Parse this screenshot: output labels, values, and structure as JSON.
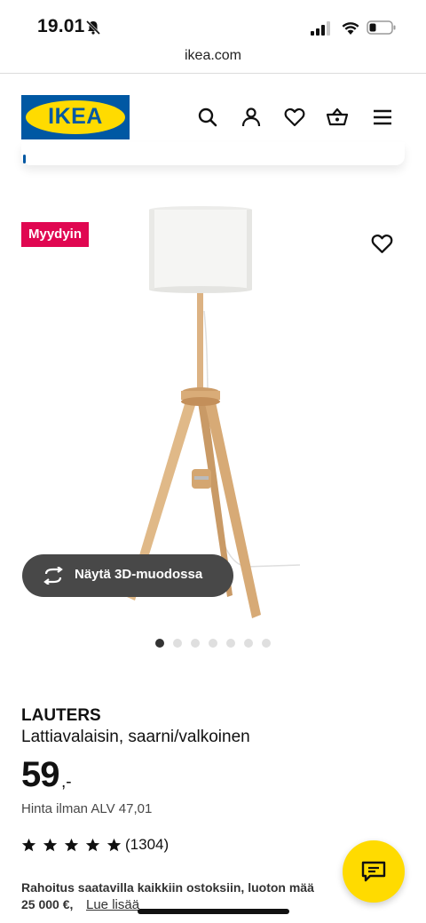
{
  "status_bar": {
    "time": "19.01",
    "icons": [
      "bell-slash-icon",
      "signal-icon",
      "wifi-icon",
      "battery-icon"
    ]
  },
  "browser": {
    "url": "ikea.com"
  },
  "header": {
    "logo_text": "IKEA",
    "icons": [
      "search-icon",
      "user-icon",
      "heart-icon",
      "cart-icon",
      "menu-icon"
    ]
  },
  "gallery": {
    "badge": "Myydyin",
    "view_3d_label": "Näytä 3D-muodossa",
    "image_count": 7,
    "active_image": 1
  },
  "product": {
    "name": "LAUTERS",
    "description": "Lattiavalaisin, saarni/valkoinen",
    "price": "59",
    "price_suffix": ",-",
    "vat_note": "Hinta ilman ALV 47,01",
    "rating": 5,
    "review_count": "(1304)",
    "financing_text": "Rahoitus saatavilla kaikkiin ostoksiin, luoton mää",
    "financing_amount": "25 000 €,",
    "read_more": "Lue lisää"
  },
  "colors": {
    "ikea_blue": "#0058a3",
    "ikea_yellow": "#ffdb00",
    "badge_red": "#e00751",
    "button_dark": "#484848"
  }
}
